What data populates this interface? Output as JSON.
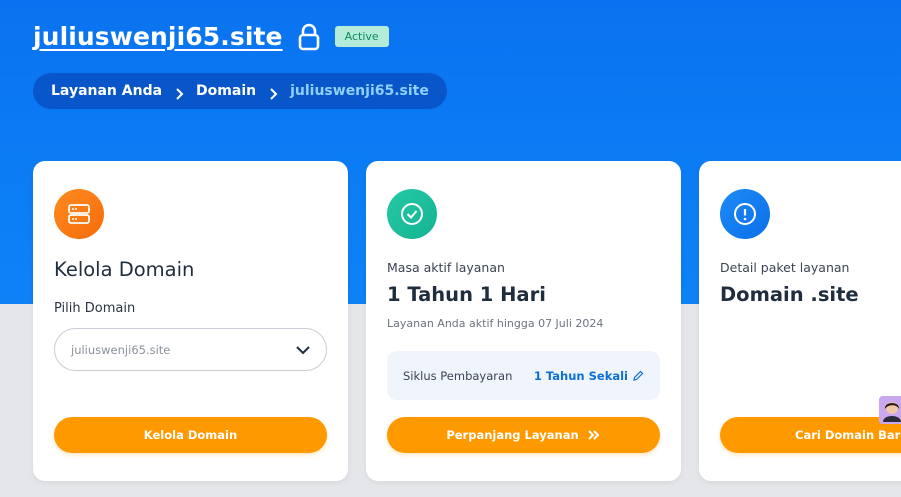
{
  "header": {
    "domain_title": "juliuswenji65.site",
    "status_badge": "Active"
  },
  "breadcrumb": {
    "items": [
      "Layanan Anda",
      "Domain",
      "juliuswenji65.site"
    ]
  },
  "card_manage": {
    "icon": "server-icon",
    "heading": "Kelola Domain",
    "field_label": "Pilih Domain",
    "select_value": "juliuswenji65.site",
    "button_label": "Kelola Domain"
  },
  "card_active": {
    "icon": "check-circle-icon",
    "label": "Masa aktif layanan",
    "value": "1 Tahun 1 Hari",
    "sub_text": "Layanan Anda aktif hingga 07 Juli 2024",
    "cycle_label": "Siklus Pembayaran",
    "cycle_value": "1 Tahun Sekali",
    "button_label": "Perpanjang Layanan"
  },
  "card_detail": {
    "icon": "alert-circle-icon",
    "label": "Detail paket layanan",
    "value": "Domain .site",
    "button_label": "Cari Domain Baru"
  },
  "colors": {
    "hero_blue": "#0c7df5",
    "accent_orange": "#ff9900",
    "badge_green": "#b4ecd9",
    "link_blue": "#0d6fd6"
  }
}
